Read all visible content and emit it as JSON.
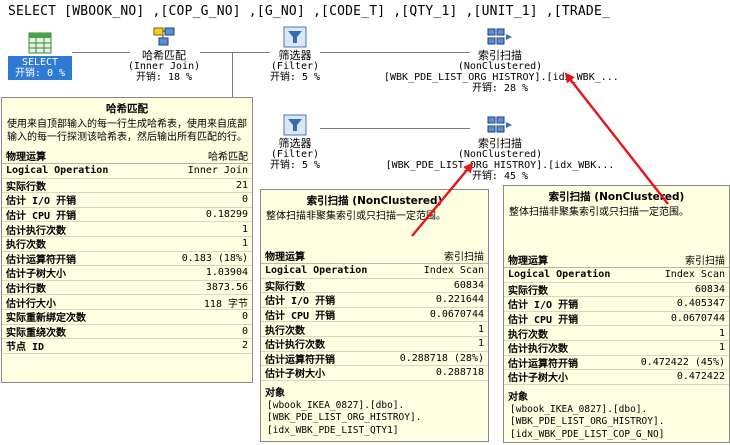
{
  "sql": "SELECT [WBOOK_NO] ,[COP_G_NO] ,[G_NO] ,[CODE_T] ,[QTY_1] ,[UNIT_1] ,[TRADE_",
  "colors": {
    "arrow": "#e8141a",
    "tooltip_bg": "#ffffe1",
    "select_bg": "#2f7bd3"
  },
  "nodes": {
    "select": {
      "icon": "table-grid-icon",
      "label": "SELECT",
      "cost": "开销: 0 %"
    },
    "hash_match": {
      "icon": "hash-match-icon",
      "name": "哈希匹配",
      "sub": "(Inner Join)",
      "cost": "开销: 18 %"
    },
    "filter_top": {
      "icon": "filter-funnel-icon",
      "name": "筛选器",
      "sub": "(Filter)",
      "cost": "开销: 5 %"
    },
    "index_scan_top": {
      "icon": "index-scan-icon",
      "name": "索引扫描",
      "sub": "(NonClustered)",
      "object": "[WBK_PDE_LIST_ORG_HISTROY].[idx_WBK_...",
      "cost": "开销: 28 %"
    },
    "filter_bottom": {
      "icon": "filter-funnel-icon",
      "name": "筛选器",
      "sub": "(Filter)",
      "cost": "开销: 5 %"
    },
    "index_scan_bottom": {
      "icon": "index-scan-icon",
      "name": "索引扫描",
      "sub": "(NonClustered)",
      "object": "[WBK_PDE_LIST_ORG_HISTROY].[idx_WBK...",
      "cost": "开销: 45 %"
    }
  },
  "tooltips": {
    "hash": {
      "title": "哈希匹配",
      "desc": "使用来自顶部输入的每一行生成哈希表，使用来自底部输入的每一行探测该哈希表，然后输出所有匹配的行。",
      "head": {
        "k": "物理运算",
        "v": "哈希匹配"
      },
      "rows": [
        {
          "k": "Logical Operation",
          "v": "Inner Join"
        },
        {
          "k": "实际行数",
          "v": "21"
        },
        {
          "k": "估计 I/O 开销",
          "v": "0"
        },
        {
          "k": "估计 CPU 开销",
          "v": "0.18299"
        },
        {
          "k": "估计执行次数",
          "v": "1"
        },
        {
          "k": "执行次数",
          "v": "1"
        },
        {
          "k": "估计运算符开销",
          "v": "0.183 (18%)"
        },
        {
          "k": "估计子树大小",
          "v": "1.03904"
        },
        {
          "k": "估计行数",
          "v": "3873.56"
        },
        {
          "k": "估计行大小",
          "v": "118 字节"
        },
        {
          "k": "实际重新绑定次数",
          "v": "0"
        },
        {
          "k": "实际重绕次数",
          "v": "0"
        },
        {
          "k": "节点 ID",
          "v": "2"
        }
      ]
    },
    "scan_mid": {
      "title": "索引扫描 (NonClustered)",
      "desc": "整体扫描非聚集索引或只扫描一定范围。",
      "head": {
        "k": "物理运算",
        "v": "索引扫描"
      },
      "rows": [
        {
          "k": "Logical Operation",
          "v": "Index Scan"
        },
        {
          "k": "实际行数",
          "v": "60834"
        },
        {
          "k": "估计 I/O 开销",
          "v": "0.221644"
        },
        {
          "k": "估计 CPU 开销",
          "v": "0.0670744"
        },
        {
          "k": "执行次数",
          "v": "1"
        },
        {
          "k": "估计执行次数",
          "v": "1"
        },
        {
          "k": "估计运算符开销",
          "v": "0.288718 (28%)"
        },
        {
          "k": "估计子树大小",
          "v": "0.288718"
        }
      ],
      "object_label": "对象",
      "object_lines": [
        "[wbook_IKEA_0827].[dbo].",
        "[WBK_PDE_LIST_ORG_HISTROY].",
        "[idx_WBK_PDE_LIST_QTY1]"
      ]
    },
    "scan_right": {
      "title": "索引扫描 (NonClustered)",
      "desc": "整体扫描非聚集索引或只扫描一定范围。",
      "head": {
        "k": "物理运算",
        "v": "索引扫描"
      },
      "rows": [
        {
          "k": "Logical Operation",
          "v": "Index Scan"
        },
        {
          "k": "实际行数",
          "v": "60834"
        },
        {
          "k": "估计 I/O 开销",
          "v": "0.405347"
        },
        {
          "k": "估计 CPU 开销",
          "v": "0.0670744"
        },
        {
          "k": "执行次数",
          "v": "1"
        },
        {
          "k": "估计执行次数",
          "v": "1"
        },
        {
          "k": "估计运算符开销",
          "v": "0.472422 (45%)"
        },
        {
          "k": "估计子树大小",
          "v": "0.472422"
        }
      ],
      "object_label": "对象",
      "object_lines": [
        "[wbook_IKEA_0827].[dbo].",
        "[WBK_PDE_LIST_ORG_HISTROY].",
        "[idx_WBK_PDE_LIST_COP_G_NO]"
      ]
    }
  }
}
